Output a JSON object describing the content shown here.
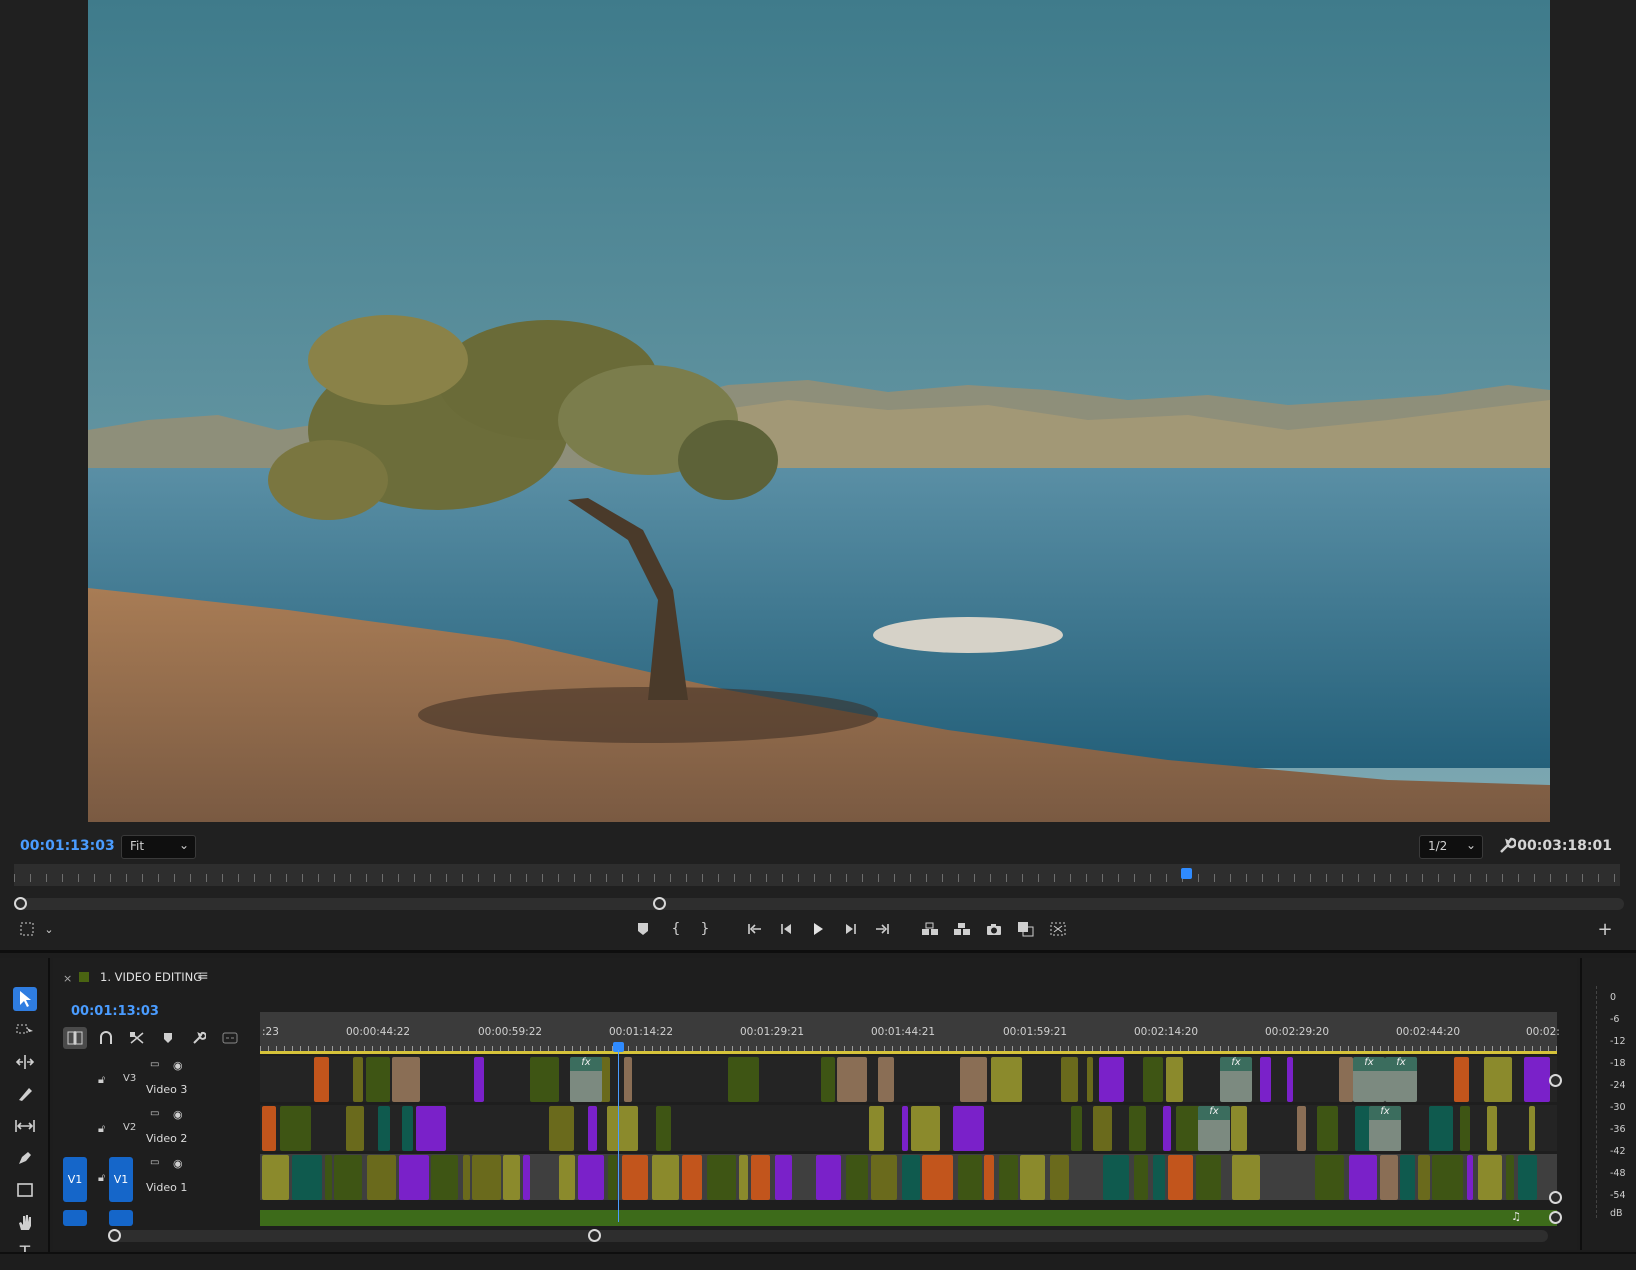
{
  "monitor": {
    "current_timecode": "00:01:13:03",
    "duration_timecode": "00:03:18:01",
    "zoom_select": "Fit",
    "resolution_select": "1/2",
    "scene": {
      "sky_top": "#437f8e",
      "sky_bottom": "#7ba6b1",
      "water": "#2f6c87",
      "ground": "#a17753",
      "hills": "#8f9484",
      "tree": "#6e6f3b"
    },
    "playhead_position": 0.735
  },
  "transport_icons": [
    "add-marker-icon",
    "mark-in-icon",
    "mark-out-icon",
    "go-to-in-icon",
    "step-back-icon",
    "play-icon",
    "step-forward-icon",
    "go-to-out-icon",
    "lift-icon",
    "extract-icon",
    "export-frame-icon",
    "comparison-view-icon",
    "toggle-proxies-icon"
  ],
  "tools": [
    "selection-tool-icon",
    "track-select-tool-icon",
    "ripple-edit-tool-icon",
    "razor-tool-icon",
    "slip-tool-icon",
    "pen-tool-icon",
    "rectangle-tool-icon",
    "hand-tool-icon",
    "type-tool-icon"
  ],
  "timeline": {
    "sequence_name": "1. VIDEO EDITING",
    "sequence_color": "#4a6412",
    "current_timecode": "00:01:13:03",
    "ruler_labels": [
      ":23",
      "00:00:44:22",
      "00:00:59:22",
      "00:01:14:22",
      "00:01:29:21",
      "00:01:44:21",
      "00:01:59:21",
      "00:02:14:20",
      "00:02:29:20",
      "00:02:44:20",
      "00:02:"
    ],
    "tracks": [
      {
        "id": "V3",
        "label": "Video 3"
      },
      {
        "id": "V2",
        "label": "Video 2"
      },
      {
        "id": "V1",
        "label": "Video 1",
        "source": "V1",
        "target": "V1"
      }
    ],
    "fx_label": "fx",
    "colors": {
      "purple": "#7a21c9",
      "olive": "#6a6a1c",
      "green": "#3e5514",
      "teal": "#0f5a4e",
      "orange": "#c2551c",
      "tan": "#8a6e55",
      "khaki": "#8b8a2c"
    }
  },
  "meter": {
    "labels": [
      "0",
      "-6",
      "-12",
      "-18",
      "-24",
      "-30",
      "-36",
      "-42",
      "-48",
      "-54",
      "dB"
    ]
  }
}
